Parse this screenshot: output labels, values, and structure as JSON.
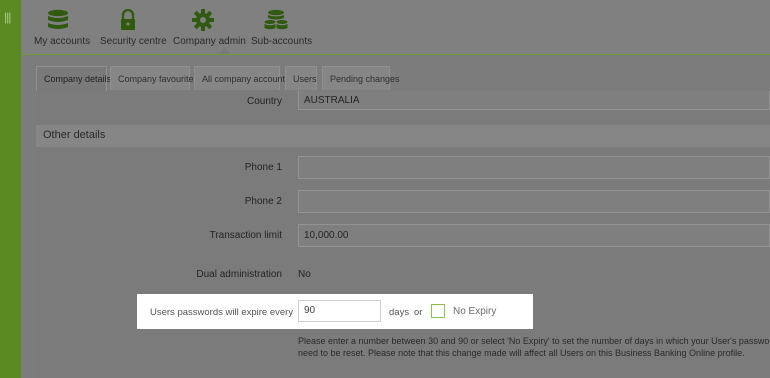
{
  "nav": {
    "items": [
      {
        "label": "My accounts",
        "icon": "database-icon"
      },
      {
        "label": "Security centre",
        "icon": "lock-icon"
      },
      {
        "label": "Company admin",
        "icon": "gear-icon"
      },
      {
        "label": "Sub-accounts",
        "icon": "stacked-database-icon"
      }
    ],
    "active": "Company admin"
  },
  "tabs": [
    "Company details",
    "Company favourites",
    "All company accounts",
    "Users",
    "Pending changes"
  ],
  "country": {
    "label": "Country",
    "value": "AUSTRALIA"
  },
  "section_title": "Other details",
  "phone1": {
    "label": "Phone 1",
    "value": ""
  },
  "phone2": {
    "label": "Phone 2",
    "value": ""
  },
  "transaction_limit": {
    "label": "Transaction limit",
    "value": "10,000.00"
  },
  "dual_admin": {
    "label": "Dual administration",
    "value": "No"
  },
  "password_expiry": {
    "label": "Users passwords will expire every",
    "value": "90",
    "days_label": "days",
    "or_label": "or",
    "no_expiry_label": "No Expiry",
    "no_expiry_checked": false
  },
  "help": {
    "line1": "Please enter a number between 30 and 90 or select 'No Expiry' to set the number of days in which your User's password w",
    "line2": "need to be reset. Please note that this change made will affect all Users on this Business Banking Online profile."
  },
  "colors": {
    "accent_green": "#5c8a22",
    "nav_icon": "#2f5a10"
  }
}
